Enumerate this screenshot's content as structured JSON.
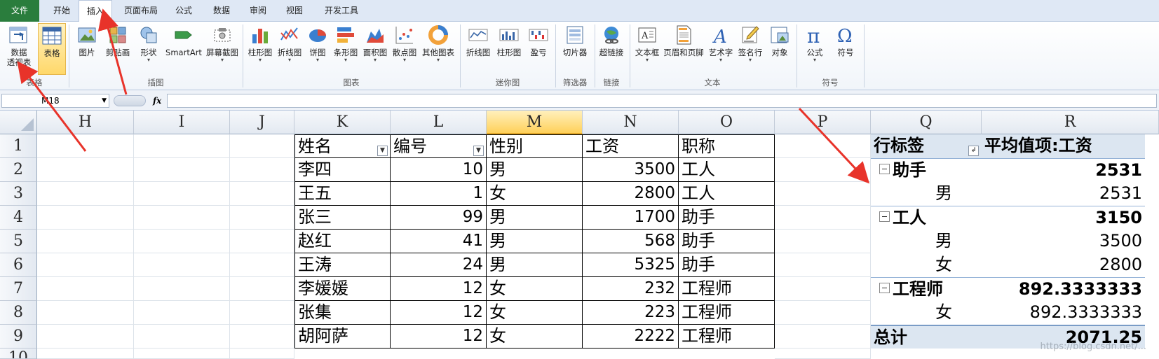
{
  "tabs": [
    "文件",
    "开始",
    "插入",
    "页面布局",
    "公式",
    "数据",
    "审阅",
    "视图",
    "开发工具"
  ],
  "active_tab": "插入",
  "ribbon": {
    "pivot_label": "数据\n透视表",
    "table_label": "表格",
    "image": "图片",
    "clipart": "剪贴画",
    "shapes": "形状",
    "smartart": "SmartArt",
    "screenshot": "屏幕截图",
    "col_chart": "柱形图",
    "line_chart": "折线图",
    "pie_chart": "饼图",
    "bar_chart": "条形图",
    "area_chart": "面积图",
    "scatter_chart": "散点图",
    "other_chart": "其他图表",
    "spark_line": "折线图",
    "spark_col": "柱形图",
    "spark_winloss": "盈亏",
    "slicer": "切片器",
    "hyperlink": "超链接",
    "textbox": "文本框",
    "header_footer": "页眉和页脚",
    "wordart": "艺术字",
    "signature": "签名行",
    "object": "对象",
    "equation": "公式",
    "symbol": "符号",
    "groups": {
      "tables": "表格",
      "illustrations": "插图",
      "charts": "图表",
      "sparklines": "迷你图",
      "filter": "筛选器",
      "links": "链接",
      "text": "文本",
      "symbols": "符号"
    }
  },
  "formula_bar": {
    "name_box": "M18",
    "fx": "fx",
    "formula": ""
  },
  "columns": [
    "H",
    "I",
    "J",
    "K",
    "L",
    "M",
    "N",
    "O",
    "P",
    "Q",
    "R"
  ],
  "rows": [
    "1",
    "2",
    "3",
    "4",
    "5",
    "6",
    "7",
    "8",
    "9",
    "10"
  ],
  "table": {
    "headers": [
      "姓名",
      "编号",
      "性别",
      "工资",
      "职称"
    ],
    "rows": [
      [
        "李四",
        "10",
        "男",
        "3500",
        "工人"
      ],
      [
        "王五",
        "1",
        "女",
        "2800",
        "工人"
      ],
      [
        "张三",
        "99",
        "男",
        "1700",
        "助手"
      ],
      [
        "赵红",
        "41",
        "男",
        "568",
        "助手"
      ],
      [
        "王涛",
        "24",
        "男",
        "5325",
        "助手"
      ],
      [
        "李媛媛",
        "12",
        "女",
        "232",
        "工程师"
      ],
      [
        "张集",
        "12",
        "女",
        "223",
        "工程师"
      ],
      [
        "胡阿萨",
        "12",
        "女",
        "2222",
        "工程师"
      ]
    ]
  },
  "pivot": {
    "row_label_header": "行标签",
    "value_header": "平均值项:工资",
    "rows": [
      {
        "label": "助手",
        "value": "2531",
        "group": true
      },
      {
        "label": "男",
        "value": "2531",
        "group": false
      },
      {
        "label": "工人",
        "value": "3150",
        "group": true
      },
      {
        "label": "男",
        "value": "3500",
        "group": false
      },
      {
        "label": "女",
        "value": "2800",
        "group": false
      },
      {
        "label": "工程师",
        "value": "892.3333333",
        "group": true
      },
      {
        "label": "女",
        "value": "892.3333333",
        "group": false
      }
    ],
    "total_label": "总计",
    "total_value": "2071.25"
  },
  "watermark": "https://blog.csdn.net/..."
}
